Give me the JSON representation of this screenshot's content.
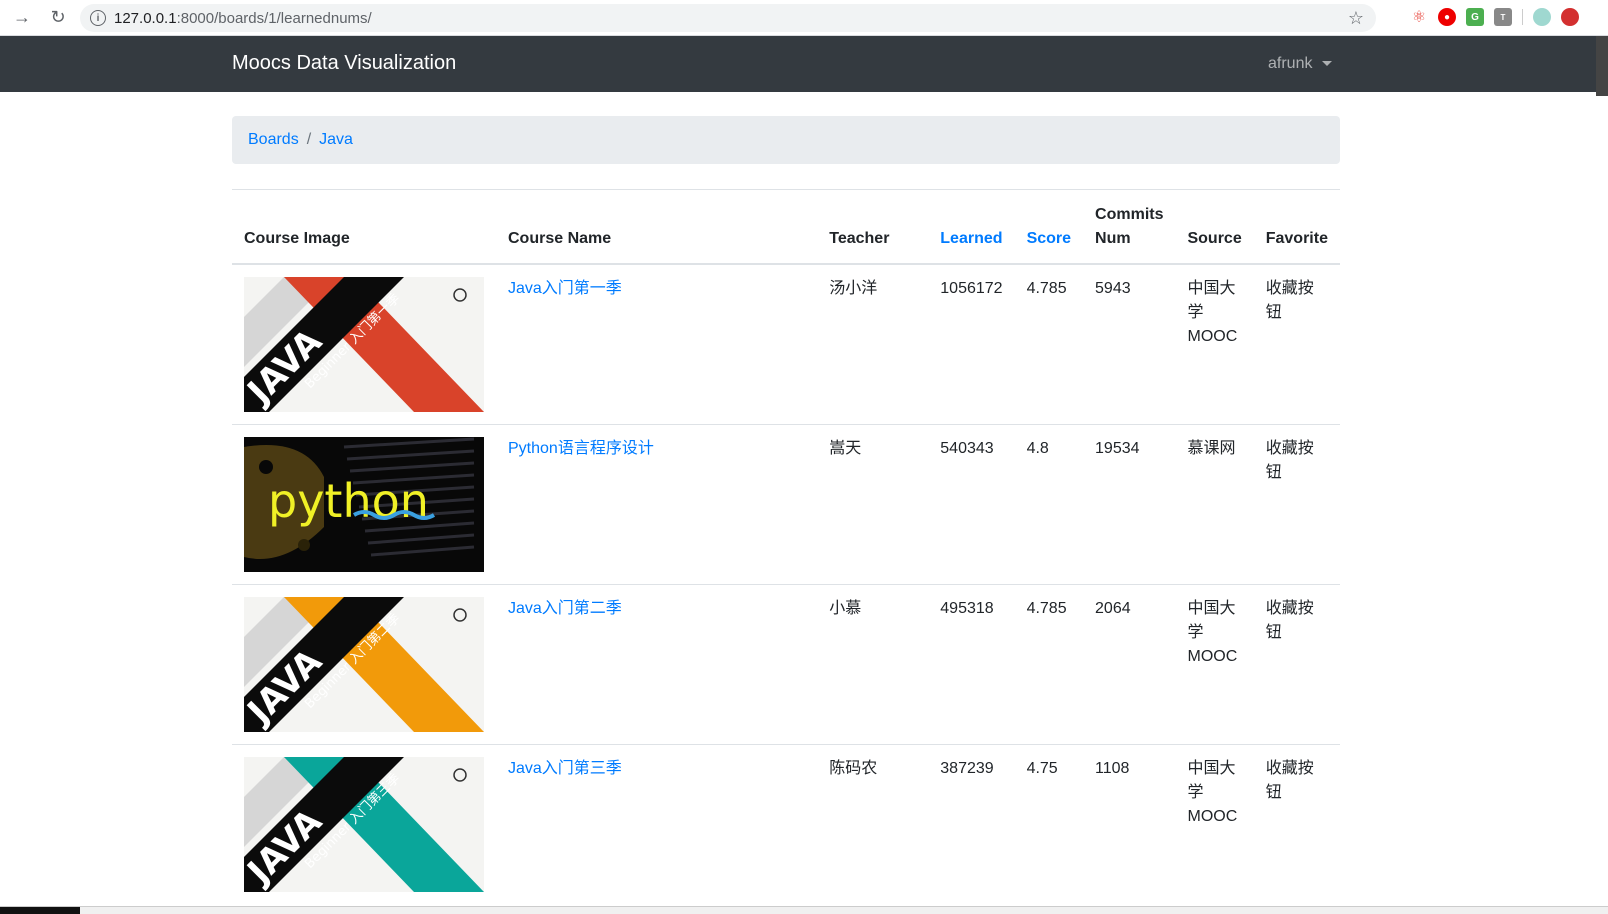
{
  "browser": {
    "url_host": "127.0.0.1",
    "url_path": ":8000/boards/1/learnednums/"
  },
  "navbar": {
    "brand": "Moocs Data Visualization",
    "user": "afrunk"
  },
  "breadcrumb": {
    "items": [
      "Boards",
      "Java"
    ]
  },
  "table": {
    "headers": {
      "image": "Course Image",
      "name": "Course Name",
      "teacher": "Teacher",
      "learned": "Learned",
      "score": "Score",
      "commits": "Commits Num",
      "source": "Source",
      "favorite": "Favorite"
    },
    "rows": [
      {
        "image": "java",
        "accent": "#d9432a",
        "name": "Java入门第一季",
        "teacher": "汤小洋",
        "learned": "1056172",
        "score": "4.785",
        "commits": "5943",
        "source": "中国大学MOOC",
        "favorite": "收藏按钮",
        "image_title": "JAVA",
        "image_sub": "Beginner 入门第一季"
      },
      {
        "image": "python",
        "name": "Python语言程序设计",
        "teacher": "嵩天",
        "learned": "540343",
        "score": "4.8",
        "commits": "19534",
        "source": "慕课网",
        "favorite": "收藏按钮",
        "image_title": "python"
      },
      {
        "image": "java",
        "accent": "#f29a0a",
        "name": "Java入门第二季",
        "teacher": "小慕",
        "learned": "495318",
        "score": "4.785",
        "commits": "2064",
        "source": "中国大学MOOC",
        "favorite": "收藏按钮",
        "image_title": "JAVA",
        "image_sub": "Beginner 入门第二季"
      },
      {
        "image": "java",
        "accent": "#0aa69a",
        "name": "Java入门第三季",
        "teacher": "陈码农",
        "learned": "387239",
        "score": "4.75",
        "commits": "1108",
        "source": "中国大学MOOC",
        "favorite": "收藏按钮",
        "image_title": "JAVA",
        "image_sub": "Beginner 入门第三季"
      }
    ]
  }
}
